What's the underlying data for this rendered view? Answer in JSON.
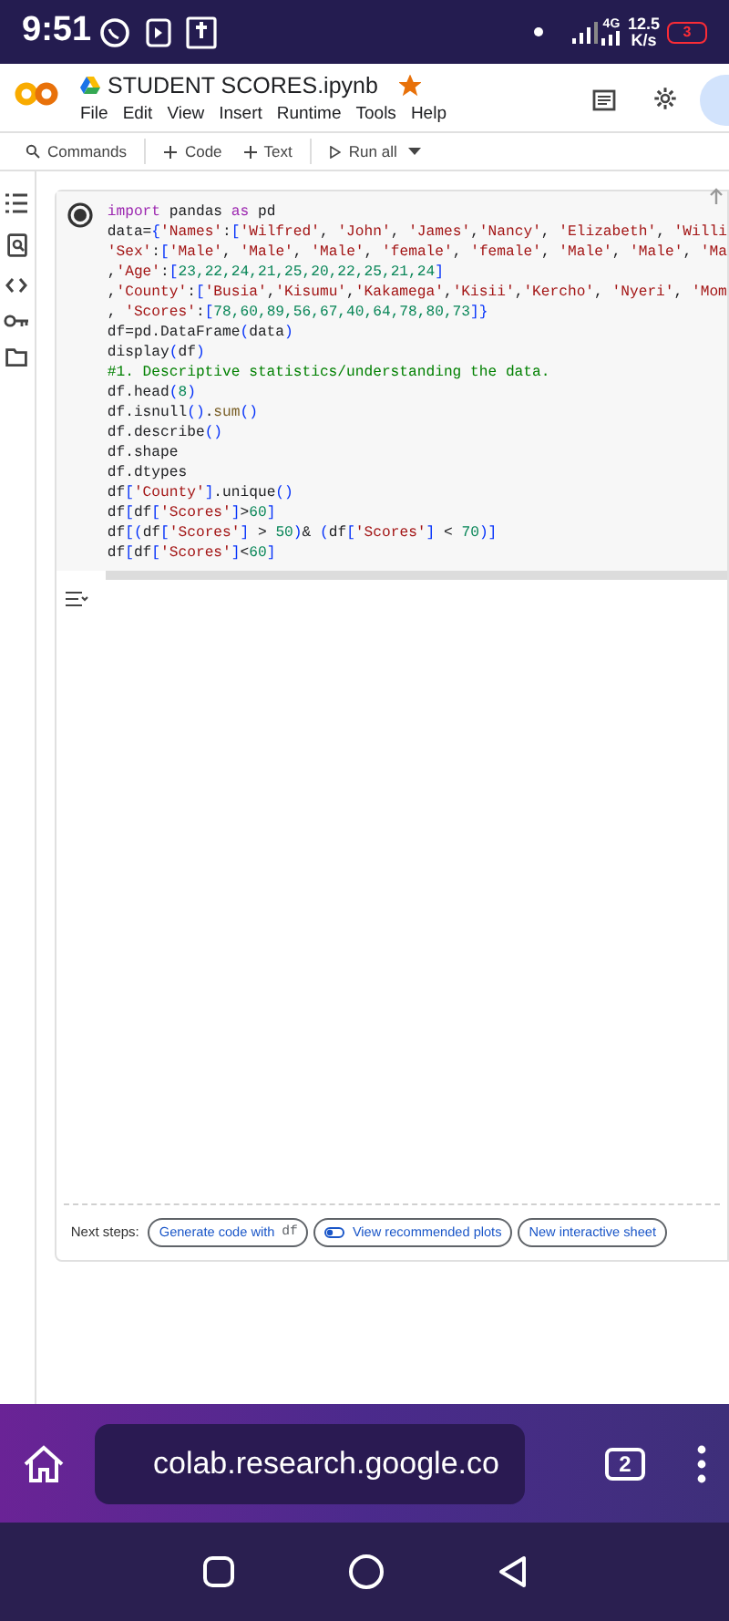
{
  "status_bar": {
    "time": "9:51",
    "network": "4G",
    "speed_value": "12.5",
    "speed_unit": "K/s",
    "battery": "3"
  },
  "notebook": {
    "title": "STUDENT SCORES.ipynb",
    "starred": true
  },
  "menu": [
    "File",
    "Edit",
    "View",
    "Insert",
    "Runtime",
    "Tools",
    "Help"
  ],
  "toolbar": [
    {
      "kind": "search",
      "label": "Commands"
    },
    {
      "kind": "add",
      "label": "Code"
    },
    {
      "kind": "add",
      "label": "Text"
    },
    {
      "kind": "run",
      "label": "Run all"
    }
  ],
  "code_lines": [
    {
      "tokens": [
        {
          "kind": "keyword",
          "text": "import"
        },
        {
          "kind": "plain",
          "text": " pandas "
        },
        {
          "kind": "keyword",
          "text": "as"
        },
        {
          "kind": "plain",
          "text": " pd"
        }
      ]
    },
    {
      "tokens": [
        {
          "kind": "plain",
          "text": "data="
        },
        {
          "kind": "bracket",
          "text": "{"
        },
        {
          "kind": "string",
          "text": "'Names'"
        },
        {
          "kind": "plain",
          "text": ":"
        },
        {
          "kind": "bracket",
          "text": "["
        },
        {
          "kind": "string",
          "text": "'Wilfred'"
        },
        {
          "kind": "plain",
          "text": ", "
        },
        {
          "kind": "string",
          "text": "'John'"
        },
        {
          "kind": "plain",
          "text": ", "
        },
        {
          "kind": "string",
          "text": "'James'"
        },
        {
          "kind": "plain",
          "text": ","
        },
        {
          "kind": "string",
          "text": "'Nancy'"
        },
        {
          "kind": "plain",
          "text": ", "
        },
        {
          "kind": "string",
          "text": "'Elizabeth'"
        },
        {
          "kind": "plain",
          "text": ", "
        },
        {
          "kind": "string",
          "text": "'Willi"
        }
      ]
    },
    {
      "tokens": [
        {
          "kind": "string",
          "text": "'Sex'"
        },
        {
          "kind": "plain",
          "text": ":"
        },
        {
          "kind": "bracket",
          "text": "["
        },
        {
          "kind": "string",
          "text": "'Male'"
        },
        {
          "kind": "plain",
          "text": ", "
        },
        {
          "kind": "string",
          "text": "'Male'"
        },
        {
          "kind": "plain",
          "text": ", "
        },
        {
          "kind": "string",
          "text": "'Male'"
        },
        {
          "kind": "plain",
          "text": ", "
        },
        {
          "kind": "string",
          "text": "'female'"
        },
        {
          "kind": "plain",
          "text": ", "
        },
        {
          "kind": "string",
          "text": "'female'"
        },
        {
          "kind": "plain",
          "text": ", "
        },
        {
          "kind": "string",
          "text": "'Male'"
        },
        {
          "kind": "plain",
          "text": ", "
        },
        {
          "kind": "string",
          "text": "'Male'"
        },
        {
          "kind": "plain",
          "text": ", "
        },
        {
          "kind": "string",
          "text": "'Ma"
        }
      ]
    },
    {
      "tokens": [
        {
          "kind": "plain",
          "text": ","
        },
        {
          "kind": "string",
          "text": "'Age'"
        },
        {
          "kind": "plain",
          "text": ":"
        },
        {
          "kind": "bracket",
          "text": "["
        },
        {
          "kind": "number",
          "text": "23,22,24,21,25,20,22,25,21,24"
        },
        {
          "kind": "bracket",
          "text": "]"
        }
      ]
    },
    {
      "tokens": [
        {
          "kind": "plain",
          "text": ","
        },
        {
          "kind": "string",
          "text": "'County'"
        },
        {
          "kind": "plain",
          "text": ":"
        },
        {
          "kind": "bracket",
          "text": "["
        },
        {
          "kind": "string",
          "text": "'Busia'"
        },
        {
          "kind": "plain",
          "text": ","
        },
        {
          "kind": "string",
          "text": "'Kisumu'"
        },
        {
          "kind": "plain",
          "text": ","
        },
        {
          "kind": "string",
          "text": "'Kakamega'"
        },
        {
          "kind": "plain",
          "text": ","
        },
        {
          "kind": "string",
          "text": "'Kisii'"
        },
        {
          "kind": "plain",
          "text": ","
        },
        {
          "kind": "string",
          "text": "'Kercho'"
        },
        {
          "kind": "plain",
          "text": ", "
        },
        {
          "kind": "string",
          "text": "'Nyeri'"
        },
        {
          "kind": "plain",
          "text": ", "
        },
        {
          "kind": "string",
          "text": "'Mom"
        }
      ]
    },
    {
      "tokens": [
        {
          "kind": "plain",
          "text": ", "
        },
        {
          "kind": "string",
          "text": "'Scores'"
        },
        {
          "kind": "plain",
          "text": ":"
        },
        {
          "kind": "bracket",
          "text": "["
        },
        {
          "kind": "number",
          "text": "78,60,89,56,67,40,64,78,80,73"
        },
        {
          "kind": "bracket",
          "text": "]}"
        }
      ]
    },
    {
      "tokens": [
        {
          "kind": "plain",
          "text": "df=pd.DataFrame"
        },
        {
          "kind": "bracket",
          "text": "("
        },
        {
          "kind": "plain",
          "text": "data"
        },
        {
          "kind": "bracket",
          "text": ")"
        }
      ]
    },
    {
      "tokens": [
        {
          "kind": "plain",
          "text": "display"
        },
        {
          "kind": "bracket",
          "text": "("
        },
        {
          "kind": "plain",
          "text": "df"
        },
        {
          "kind": "bracket",
          "text": ")"
        }
      ]
    },
    {
      "tokens": [
        {
          "kind": "comment",
          "text": "#1. Descriptive statistics/understanding the data."
        }
      ]
    },
    {
      "tokens": [
        {
          "kind": "plain",
          "text": "df.head"
        },
        {
          "kind": "bracket",
          "text": "("
        },
        {
          "kind": "number",
          "text": "8"
        },
        {
          "kind": "bracket",
          "text": ")"
        }
      ]
    },
    {
      "tokens": [
        {
          "kind": "plain",
          "text": "df.isnull"
        },
        {
          "kind": "bracket",
          "text": "()"
        },
        {
          "kind": "plain",
          "text": "."
        },
        {
          "kind": "builtin",
          "text": "sum"
        },
        {
          "kind": "bracket",
          "text": "()"
        }
      ]
    },
    {
      "tokens": [
        {
          "kind": "plain",
          "text": "df.describe"
        },
        {
          "kind": "bracket",
          "text": "()"
        }
      ]
    },
    {
      "tokens": [
        {
          "kind": "plain",
          "text": "df.shape"
        }
      ]
    },
    {
      "tokens": [
        {
          "kind": "plain",
          "text": "df.dtypes"
        }
      ]
    },
    {
      "tokens": [
        {
          "kind": "plain",
          "text": "df"
        },
        {
          "kind": "bracket",
          "text": "["
        },
        {
          "kind": "string",
          "text": "'County'"
        },
        {
          "kind": "bracket",
          "text": "]"
        },
        {
          "kind": "plain",
          "text": ".unique"
        },
        {
          "kind": "bracket",
          "text": "()"
        }
      ]
    },
    {
      "tokens": [
        {
          "kind": "plain",
          "text": "df"
        },
        {
          "kind": "bracket",
          "text": "["
        },
        {
          "kind": "plain",
          "text": "df"
        },
        {
          "kind": "bracket",
          "text": "["
        },
        {
          "kind": "string",
          "text": "'Scores'"
        },
        {
          "kind": "bracket",
          "text": "]"
        },
        {
          "kind": "plain",
          "text": ">"
        },
        {
          "kind": "number",
          "text": "60"
        },
        {
          "kind": "bracket",
          "text": "]"
        }
      ]
    },
    {
      "tokens": [
        {
          "kind": "plain",
          "text": "df"
        },
        {
          "kind": "bracket",
          "text": "[("
        },
        {
          "kind": "plain",
          "text": "df"
        },
        {
          "kind": "bracket",
          "text": "["
        },
        {
          "kind": "string",
          "text": "'Scores'"
        },
        {
          "kind": "bracket",
          "text": "]"
        },
        {
          "kind": "plain",
          "text": " > "
        },
        {
          "kind": "number",
          "text": "50"
        },
        {
          "kind": "bracket",
          "text": ")"
        },
        {
          "kind": "plain",
          "text": "& "
        },
        {
          "kind": "bracket",
          "text": "("
        },
        {
          "kind": "plain",
          "text": "df"
        },
        {
          "kind": "bracket",
          "text": "["
        },
        {
          "kind": "string",
          "text": "'Scores'"
        },
        {
          "kind": "bracket",
          "text": "]"
        },
        {
          "kind": "plain",
          "text": " < "
        },
        {
          "kind": "number",
          "text": "70"
        },
        {
          "kind": "bracket",
          "text": ")]"
        }
      ]
    },
    {
      "tokens": [
        {
          "kind": "plain",
          "text": "df"
        },
        {
          "kind": "bracket",
          "text": "["
        },
        {
          "kind": "plain",
          "text": "df"
        },
        {
          "kind": "bracket",
          "text": "["
        },
        {
          "kind": "string",
          "text": "'Scores'"
        },
        {
          "kind": "bracket",
          "text": "]"
        },
        {
          "kind": "plain",
          "text": "<"
        },
        {
          "kind": "number",
          "text": "60"
        },
        {
          "kind": "bracket",
          "text": "]"
        }
      ]
    }
  ],
  "next_steps": {
    "label": "Next steps:",
    "chips": [
      {
        "kind": "code",
        "label": "Generate code with",
        "code": "df"
      },
      {
        "kind": "plots",
        "label": "View recommended plots"
      },
      {
        "kind": "plain",
        "label": "New interactive sheet"
      }
    ]
  },
  "browser": {
    "url": "colab.research.google.co",
    "tab_count": "2"
  }
}
